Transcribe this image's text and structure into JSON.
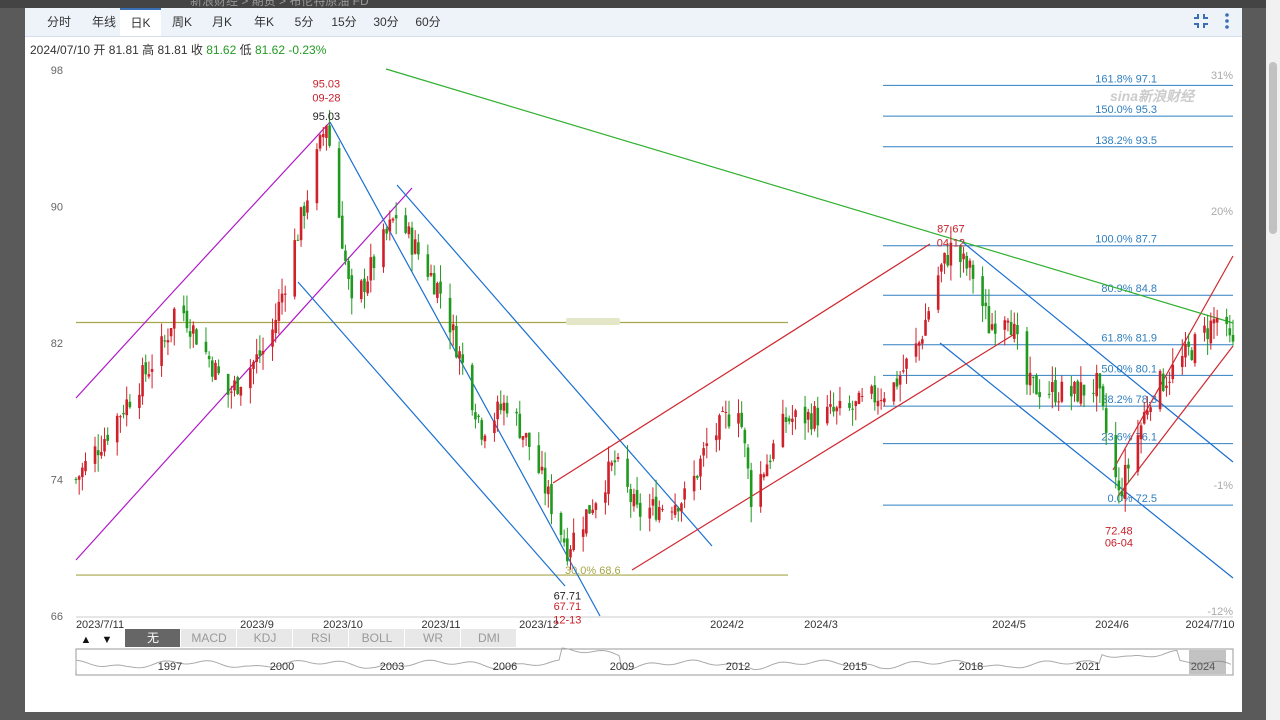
{
  "breadcrumb": "新浪财经 > 期货 > 布伦特原油 FD",
  "tabs": [
    "分时",
    "年线",
    "日K",
    "周K",
    "月K",
    "年K",
    "5分",
    "15分",
    "30分",
    "60分"
  ],
  "active_tab": "日K",
  "toolbar_icons": [
    "fullscreen-icon",
    "more-icon"
  ],
  "info": {
    "date": "2024/07/10",
    "open_label": "开",
    "open": "81.81",
    "high_label": "高",
    "high": "81.81",
    "close_label": "收",
    "close": "81.62",
    "low_label": "低",
    "low": "81.62",
    "change": "-0.23%"
  },
  "indicator_tabs": [
    "无",
    "MACD",
    "KDJ",
    "RSI",
    "BOLL",
    "WR",
    "DMI"
  ],
  "active_indicator": "无",
  "nav_arrows": [
    "▲",
    "▼"
  ],
  "navigator_years": [
    "1997",
    "2000",
    "2003",
    "2006",
    "2009",
    "2012",
    "2015",
    "2018",
    "2021",
    "2024"
  ],
  "watermark": "sina新浪财经",
  "chart_data": {
    "type": "candlestick",
    "yticks": [
      "98",
      "90",
      "82",
      "74",
      "66"
    ],
    "right_ticks": [
      "31%",
      "20%",
      "-1%",
      "-12%"
    ],
    "xticks": [
      "2023/7/11",
      "2023/9",
      "2023/10",
      "2023/11",
      "2023/12",
      "2024/2",
      "2024/3",
      "2024/5",
      "2024/6",
      "2024/7/10"
    ],
    "ylim": [
      66,
      98
    ],
    "annotations": [
      {
        "text": "95.03",
        "color": "#c8202a",
        "price": 97.2,
        "date": "2023/9/28"
      },
      {
        "text": "09-28",
        "color": "#c8202a",
        "price": 96.4,
        "date": "2023/9/28"
      },
      {
        "text": "95.03",
        "color": "#222",
        "price": 95.3,
        "date": "2023/9/28"
      },
      {
        "text": "87.67",
        "color": "#c8202a",
        "price": 88.7,
        "date": "2024/4/12"
      },
      {
        "text": "04-12",
        "color": "#c8202a",
        "price": 87.9,
        "date": "2024/4/12"
      },
      {
        "text": "67.71",
        "color": "#222",
        "price": 67.2,
        "date": "2023/12/13"
      },
      {
        "text": "67.71",
        "color": "#c8202a",
        "price": 66.6,
        "date": "2023/12/13"
      },
      {
        "text": "12-13",
        "color": "#c8202a",
        "price": 65.8,
        "date": "2023/12/13"
      },
      {
        "text": "72.48",
        "color": "#c8202a",
        "price": 71.0,
        "date": "2024/6/4"
      },
      {
        "text": "06-04",
        "color": "#c8202a",
        "price": 70.3,
        "date": "2024/6/4"
      }
    ],
    "fibonacci": [
      {
        "label": "161.8% 97.1",
        "price": 97.1
      },
      {
        "label": "150.0% 95.3",
        "price": 95.3
      },
      {
        "label": "138.2% 93.5",
        "price": 93.5
      },
      {
        "label": "100.0% 87.7",
        "price": 87.7
      },
      {
        "label": "80.9% 84.8",
        "price": 84.8
      },
      {
        "label": "61.8% 81.9",
        "price": 81.9
      },
      {
        "label": "50.0% 80.1",
        "price": 80.1
      },
      {
        "label": "38.2% 78.3",
        "price": 78.3
      },
      {
        "label": "23.6% 76.1",
        "price": 76.1
      },
      {
        "label": "0.0% 72.5",
        "price": 72.5
      }
    ],
    "horizontal_levels": [
      {
        "price": 83.2,
        "label": ""
      },
      {
        "price": 68.4,
        "label": "30.0% 68.6"
      }
    ],
    "anchors": [
      [
        "2023/7/11",
        74
      ],
      [
        "2023/7/20",
        76.5
      ],
      [
        "2023/8/8",
        82
      ],
      [
        "2023/8/12",
        84.5
      ],
      [
        "2023/8/28",
        79
      ],
      [
        "2023/9/10",
        82
      ],
      [
        "2023/9/28",
        95
      ],
      [
        "2023/10/6",
        84
      ],
      [
        "2023/10/20",
        89.5
      ],
      [
        "2023/11/3",
        85
      ],
      [
        "2023/11/16",
        77
      ],
      [
        "2023/11/24",
        78.5
      ],
      [
        "2023/12/1",
        76
      ],
      [
        "2023/12/13",
        70
      ],
      [
        "2023/12/28",
        75
      ],
      [
        "2024/1/4",
        72
      ],
      [
        "2024/1/20",
        73
      ],
      [
        "2024/1/26",
        76
      ],
      [
        "2024/2/5",
        78.5
      ],
      [
        "2024/2/9",
        73
      ],
      [
        "2024/2/20",
        77.5
      ],
      [
        "2024/3/11",
        78
      ],
      [
        "2024/3/25",
        79.5
      ],
      [
        "2024/4/2",
        82
      ],
      [
        "2024/4/8",
        86
      ],
      [
        "2024/4/12",
        87.5
      ],
      [
        "2024/4/19",
        86
      ],
      [
        "2024/4/24",
        83
      ],
      [
        "2024/4/30",
        84
      ],
      [
        "2024/5/6",
        79.5
      ],
      [
        "2024/5/20",
        79
      ],
      [
        "2024/5/28",
        79.5
      ],
      [
        "2024/6/4",
        73
      ],
      [
        "2024/6/14",
        79
      ],
      [
        "2024/6/24",
        81
      ],
      [
        "2024/7/5",
        83.5
      ],
      [
        "2024/7/10",
        81.6
      ]
    ]
  }
}
